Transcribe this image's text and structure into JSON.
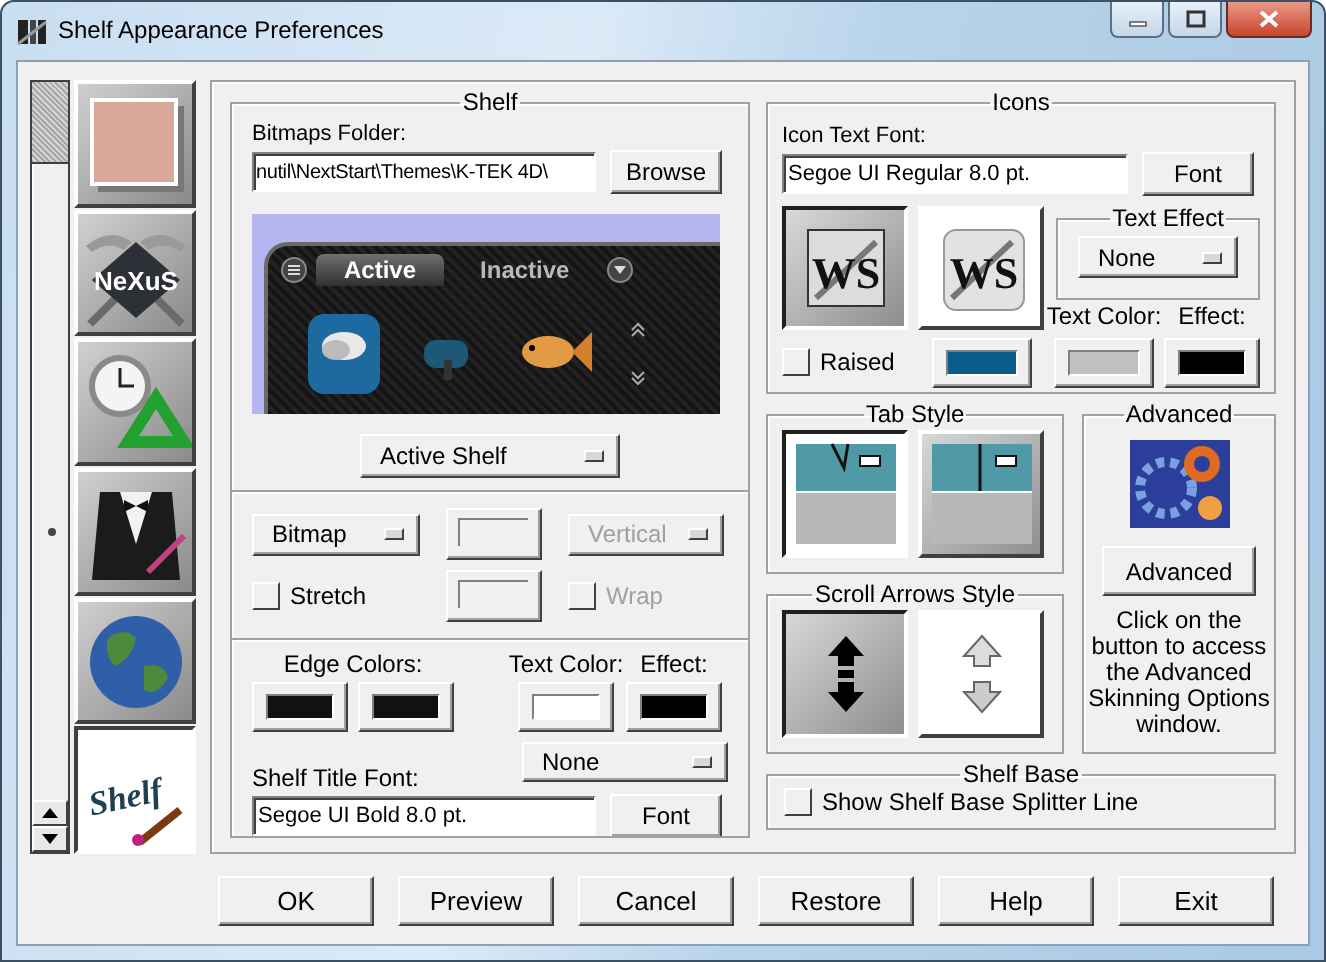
{
  "window": {
    "title": "Shelf Appearance Preferences"
  },
  "sidebar": {
    "tiles": [
      {
        "kind": "photo",
        "selected": false
      },
      {
        "kind": "hammers-logo",
        "label": "NeXuS",
        "selected": false
      },
      {
        "kind": "clock-recycle",
        "selected": false
      },
      {
        "kind": "tuxedo",
        "selected": false
      },
      {
        "kind": "globe",
        "selected": false
      },
      {
        "kind": "shelf-logo",
        "label": "Shelf",
        "selected": true
      }
    ]
  },
  "shelf": {
    "title": "Shelf",
    "bitmaps_folder": {
      "label": "Bitmaps Folder:",
      "value": "nutil\\NextStart\\Themes\\K-TEK 4D\\"
    },
    "browse_button": "Browse",
    "preview": {
      "tabs": [
        {
          "label": "Active",
          "selected": true
        },
        {
          "label": "Inactive",
          "selected": false
        }
      ]
    },
    "shelf_select": {
      "value": "Active Shelf",
      "disabled": false
    },
    "fill_select": {
      "value": "Bitmap",
      "disabled": false
    },
    "stretch": {
      "label": "Stretch",
      "checked": false,
      "disabled": false
    },
    "orientation_select": {
      "value": "Vertical",
      "disabled": true
    },
    "wrap": {
      "label": "Wrap",
      "checked": false,
      "disabled": true
    },
    "edge_colors": {
      "label": "Edge Colors:",
      "swatches": [
        {
          "color": "#111111"
        },
        {
          "color": "#111111"
        }
      ]
    },
    "text_color": {
      "label": "Text Color:",
      "color": "#ffffff"
    },
    "effect": {
      "label": "Effect:",
      "color": "#000000"
    },
    "effect_select": {
      "value": "None",
      "disabled": false
    },
    "title_font": {
      "label": "Shelf Title Font:",
      "value": "Segoe UI Bold 8.0 pt."
    },
    "font_button": "Font"
  },
  "icons": {
    "title": "Icons",
    "font": {
      "label": "Icon Text Font:",
      "value": "Segoe UI Regular 8.0 pt."
    },
    "font_button": "Font",
    "styles": [
      {
        "kind": "framed-logo",
        "label": "WS",
        "selected": true
      },
      {
        "kind": "plain-logo",
        "label": "WS",
        "selected": false
      }
    ],
    "text_effect": {
      "title": "Text Effect",
      "value": "None",
      "disabled": false
    },
    "raised": {
      "label": "Raised",
      "checked": false,
      "disabled": false
    },
    "background": {
      "color": "#0b5e8c"
    },
    "text_color": {
      "label": "Text Color:",
      "color": "#c0c0c0"
    },
    "effect": {
      "label": "Effect:",
      "color": "#000000"
    }
  },
  "tab_style": {
    "title": "Tab Style",
    "options": [
      {
        "kind": "slanted-tab",
        "selected": true
      },
      {
        "kind": "square-tab",
        "selected": false
      }
    ]
  },
  "scroll_arrows": {
    "title": "Scroll Arrows Style",
    "options": [
      {
        "kind": "solid-arrows",
        "selected": true
      },
      {
        "kind": "outline-arrows",
        "selected": false
      }
    ]
  },
  "advanced": {
    "title": "Advanced",
    "button": "Advanced",
    "description": "Click on the button to access the Advanced Skinning Options window."
  },
  "shelf_base": {
    "title": "Shelf Base",
    "splitter": {
      "label": "Show Shelf Base Splitter Line",
      "checked": false,
      "disabled": false
    }
  },
  "buttons": [
    "OK",
    "Preview",
    "Cancel",
    "Restore",
    "Help",
    "Exit"
  ]
}
